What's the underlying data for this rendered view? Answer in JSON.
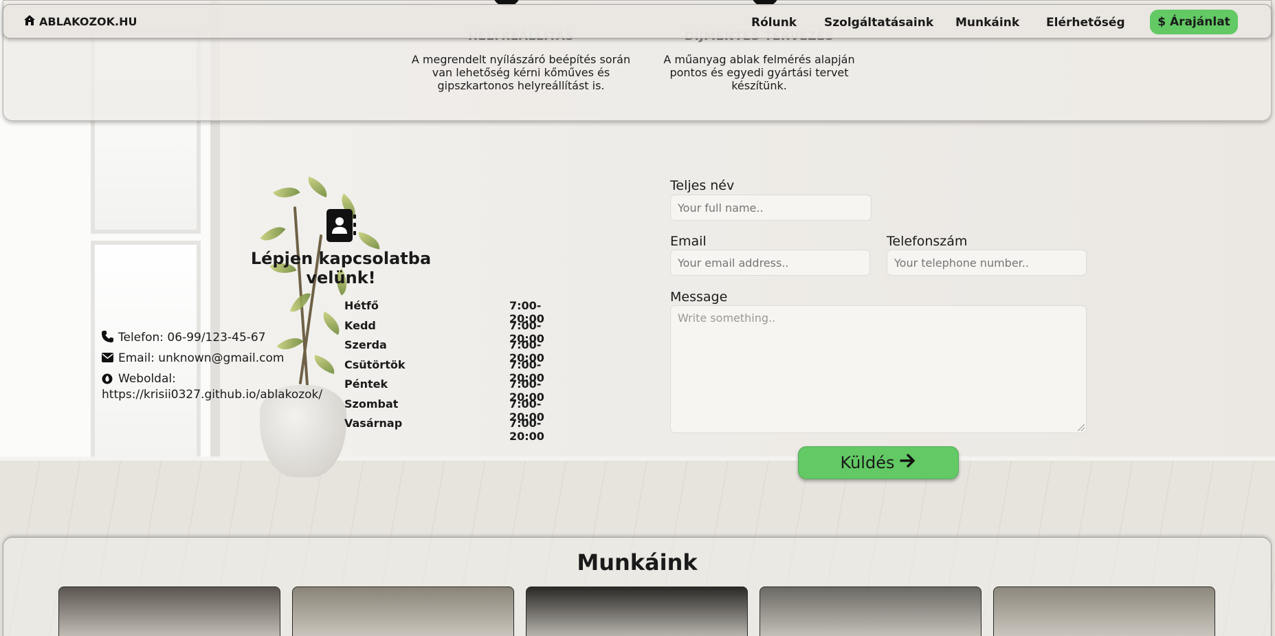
{
  "navbar": {
    "brand": "ABLAKOZOK.HU",
    "brand_icon": "house-icon",
    "items": [
      {
        "label": "Rólunk"
      },
      {
        "label": "Szolgáltatásaink"
      },
      {
        "label": "Munkáink"
      },
      {
        "label": "Elérhetőség"
      }
    ],
    "quote_button": "$ Árajánlat"
  },
  "services": [
    {
      "title": "HELYREÁLLÍTÁS",
      "line1": "A megrendelt nyílászáró beépítés során",
      "line2": "van lehetőség kérni kőműves és",
      "line3": "gipszkartonos helyreállítást is."
    },
    {
      "title": "DÍJMENTES TERVEZÉS",
      "line1": "A műanyag ablak felmérés alapján",
      "line2": "pontos és egyedi gyártási tervet",
      "line3": "készítünk."
    }
  ],
  "contact": {
    "icon": "contact-book-icon",
    "title": "Lépjen kapcsolatba velünk!",
    "phone": "Telefon: 06-99/123-45-67",
    "email": "Email: unknown@gmail.com",
    "website_label": "Weboldal:",
    "website_url": "https://krisii0327.github.io/ablakozok/",
    "hours": [
      {
        "day": "Hétfő",
        "time": "7:00-20:00"
      },
      {
        "day": "Kedd",
        "time": "7:00-20:00"
      },
      {
        "day": "Szerda",
        "time": "7:00-20:00"
      },
      {
        "day": "Csütörtök",
        "time": "7:00-20:00"
      },
      {
        "day": "Péntek",
        "time": "7:00-20:00"
      },
      {
        "day": "Szombat",
        "time": "7:00-20:00"
      },
      {
        "day": "Vasárnap",
        "time": "7:00-20:00"
      }
    ]
  },
  "form": {
    "name_label": "Teljes név",
    "name_placeholder": "Your full name..",
    "email_label": "Email",
    "email_placeholder": "Your email address..",
    "phone_label": "Telefonszám",
    "phone_placeholder": "Your telephone number..",
    "message_label": "Message",
    "message_placeholder": "Write something..",
    "submit_label": "Küldés",
    "submit_icon": "arrow-right-icon"
  },
  "works": {
    "title": "Munkáink",
    "thumb_colors": [
      "#5b5750",
      "#8a8478",
      "#2b2927",
      "#6b6963",
      "#8d887d"
    ]
  },
  "colors": {
    "accent_green": "#62c964"
  }
}
